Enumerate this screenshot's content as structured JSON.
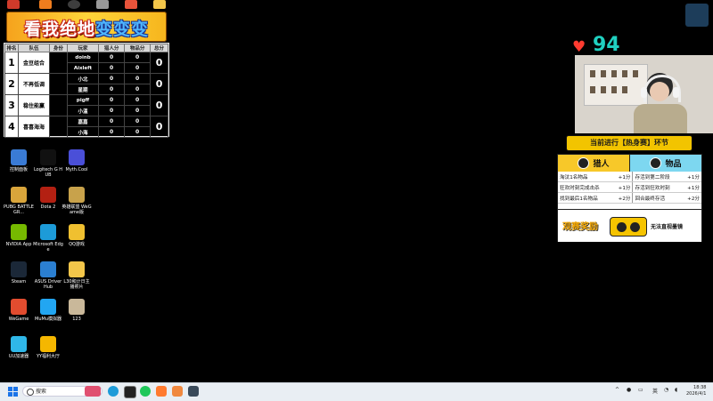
{
  "banner": {
    "title_a": "看我绝地",
    "title_b": "变变变"
  },
  "score_table": {
    "headers": [
      "排名",
      "队伍",
      "身份",
      "玩家",
      "猎人分",
      "物品分",
      "总分"
    ],
    "rows": [
      {
        "rank": "1",
        "team": "金豆组合",
        "players": [
          {
            "name": "doinb",
            "hunter": "0",
            "item": "0"
          },
          {
            "name": "Aixleft",
            "hunter": "0",
            "item": "0"
          }
        ],
        "total": "0"
      },
      {
        "rank": "2",
        "team": "不再低调",
        "players": [
          {
            "name": "小北",
            "hunter": "0",
            "item": "0"
          },
          {
            "name": "星期",
            "hunter": "0",
            "item": "0"
          }
        ],
        "total": "0"
      },
      {
        "rank": "3",
        "team": "稳住能赢",
        "players": [
          {
            "name": "pigff",
            "hunter": "0",
            "item": "0"
          },
          {
            "name": "小温",
            "hunter": "0",
            "item": "0"
          }
        ],
        "total": "0"
      },
      {
        "rank": "4",
        "team": "喜喜海海",
        "players": [
          {
            "name": "嘉嘉",
            "hunter": "0",
            "item": "0"
          },
          {
            "name": "小海",
            "hunter": "0",
            "item": "0"
          }
        ],
        "total": "0"
      }
    ]
  },
  "desktop_icons": [
    {
      "label": "控制面板",
      "icon": "control-panel-icon",
      "color": "#3a7bd5"
    },
    {
      "label": "Logitech G HUB",
      "icon": "logitech-icon",
      "color": "#111111"
    },
    {
      "label": "Myth.Cool",
      "icon": "myth-icon",
      "color": "#4a4fd8"
    },
    {
      "label": "PUBG BATTLEGR...",
      "icon": "pubg-icon",
      "color": "#d9a53b"
    },
    {
      "label": "Dota 2",
      "icon": "dota-icon",
      "color": "#b32012"
    },
    {
      "label": "英雄联盟 WeGame版",
      "icon": "lol-icon",
      "color": "#c8a24b"
    },
    {
      "label": "NVIDIA App",
      "icon": "nvidia-icon",
      "color": "#76b900"
    },
    {
      "label": "Microsoft Edge",
      "icon": "edge-icon",
      "color": "#1d9bd8"
    },
    {
      "label": "QQ游戏",
      "icon": "qq-game-icon",
      "color": "#f0c030"
    },
    {
      "label": "Steam",
      "icon": "steam-icon",
      "color": "#1b2838"
    },
    {
      "label": "ASUS DriverHub",
      "icon": "asus-icon",
      "color": "#2b7fd1"
    },
    {
      "label": "L30和计日主播照片",
      "icon": "folder-icon",
      "color": "#f3c64a"
    },
    {
      "label": "WeGame",
      "icon": "wegame-icon",
      "color": "#e24c2f"
    },
    {
      "label": "MuMu模拟器",
      "icon": "mumu-icon",
      "color": "#22a6f2"
    },
    {
      "label": "123",
      "icon": "image-file-icon",
      "color": "#c9b89a"
    },
    {
      "label": "UU加速器",
      "icon": "uu-icon",
      "color": "#2fb7e8"
    },
    {
      "label": "YY福利大厅",
      "icon": "yy-icon",
      "color": "#f5b700"
    }
  ],
  "stream": {
    "hearts": "94",
    "stage": "当前进行【热身赛】环节",
    "hunter_label": "猎人",
    "item_label": "物品",
    "hunter_rules": [
      {
        "text": "淘汰1名物品",
        "pts": "+1分"
      },
      {
        "text": "狂欢时刻完成击杀",
        "pts": "+1分"
      },
      {
        "text": "找到最后1名物品",
        "pts": "+2分"
      }
    ],
    "item_rules": [
      {
        "text": "存活到第二阶段",
        "pts": "+1分"
      },
      {
        "text": "存活到狂欢时刻",
        "pts": "+1分"
      },
      {
        "text": "回合最终存活",
        "pts": "+2分"
      }
    ],
    "reward_label": "观赛奖励",
    "reward_text": "无法直视墨镜"
  },
  "taskbar": {
    "search_placeholder": "搜索",
    "time": "18:38",
    "date": "2026/4/1",
    "lang": "英"
  },
  "colors": {
    "banner_gold": "#f5a21c",
    "stage_yellow": "#f2c400",
    "hunter_header": "#f7c829",
    "item_header": "#7dd7f0",
    "heart": "#ff3b30",
    "heart_count": "#20d0c0"
  }
}
